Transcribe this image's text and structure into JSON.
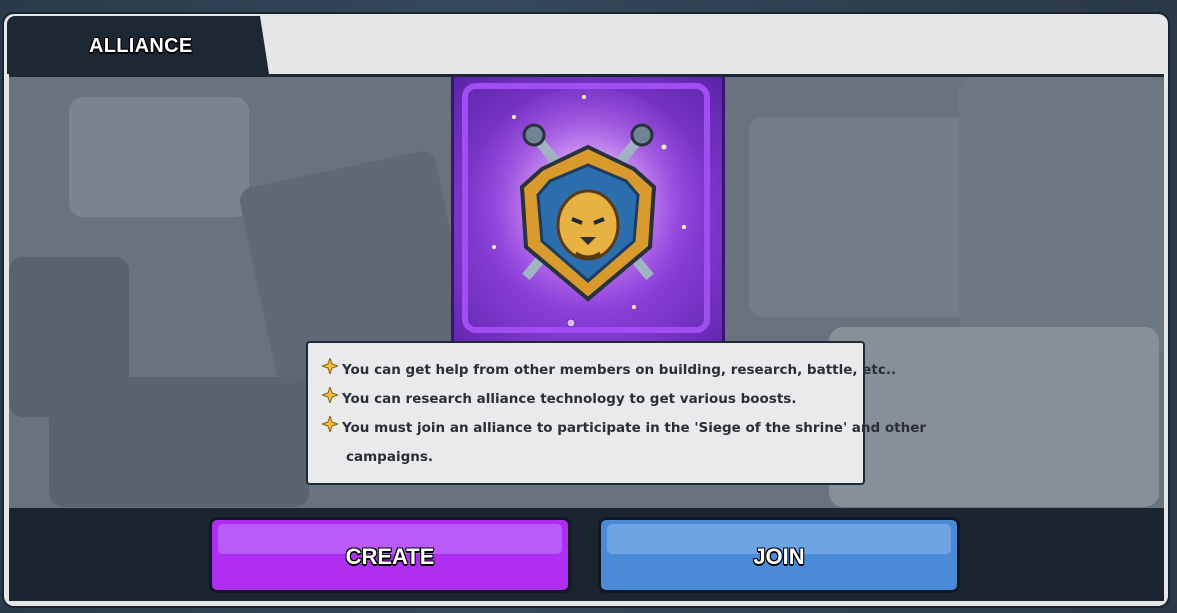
{
  "window": {
    "tab_title": "ALLIANCE"
  },
  "emblem": {
    "icon": "lion-shield-emblem",
    "accent": "#8b3fd8"
  },
  "info": {
    "bullets": [
      "You can get help from other members on building, research, battle, etc..",
      "You can research alliance technology to get various boosts.",
      "You must join an alliance to participate in the 'Siege of the shrine' and other"
    ],
    "continuation": "campaigns."
  },
  "buttons": {
    "create": {
      "label": "CREATE",
      "color": "#b02ef2"
    },
    "join": {
      "label": "JOIN",
      "color": "#4a8ad6"
    }
  }
}
